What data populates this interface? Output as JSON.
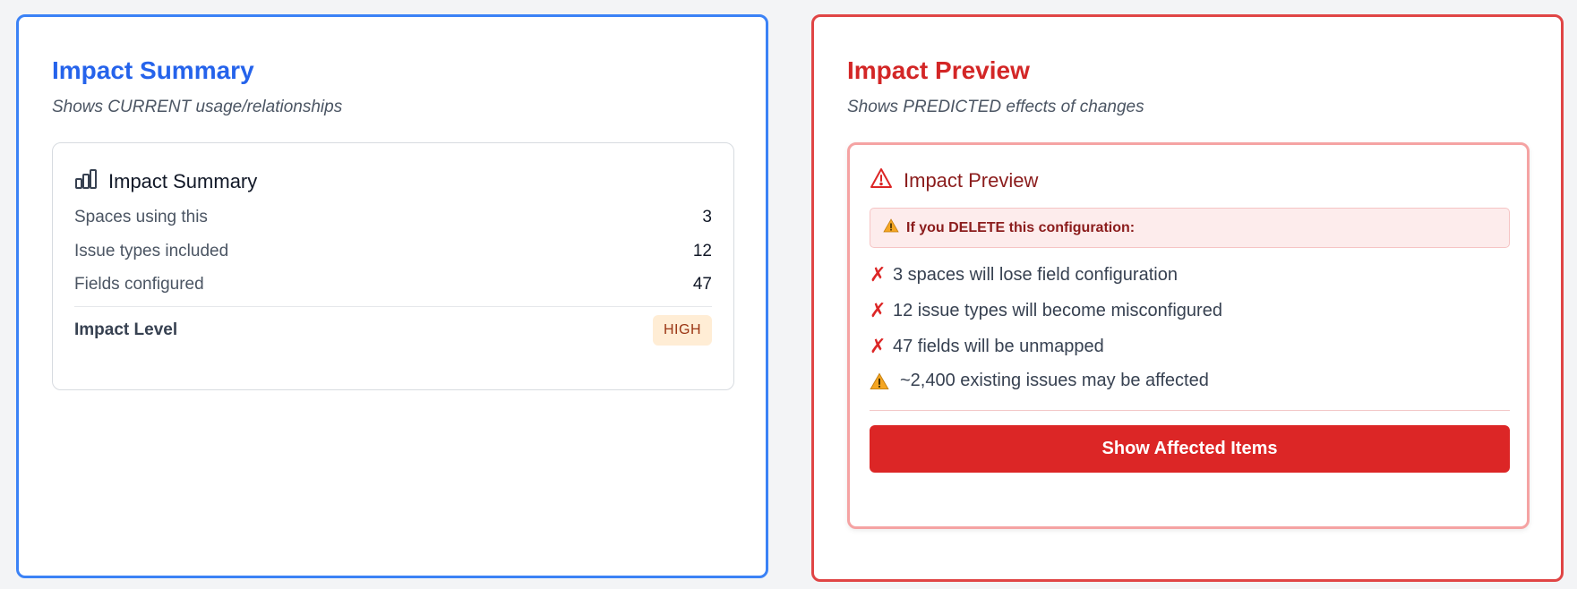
{
  "left_panel": {
    "title": "Impact Summary",
    "subtitle": "Shows CURRENT usage/relationships",
    "card": {
      "icon": "bar-chart-icon",
      "title": "Impact Summary",
      "stats": [
        {
          "label": "Spaces using this",
          "value": "3"
        },
        {
          "label": "Issue types included",
          "value": "12"
        },
        {
          "label": "Fields configured",
          "value": "47"
        }
      ],
      "impact_level_label": "Impact Level",
      "impact_level_value": "HIGH"
    }
  },
  "right_panel": {
    "title": "Impact Preview",
    "subtitle": "Shows PREDICTED effects of changes",
    "card": {
      "icon": "warning-triangle-icon",
      "title": "Impact Preview",
      "alert_text": "If you DELETE this configuration:",
      "effects": [
        {
          "icon": "x-mark-icon",
          "text": "3 spaces will lose field configuration"
        },
        {
          "icon": "x-mark-icon",
          "text": "12 issue types will become misconfigured"
        },
        {
          "icon": "x-mark-icon",
          "text": "47 fields will be unmapped"
        },
        {
          "icon": "warning-icon",
          "text": "~2,400 existing issues may be affected"
        }
      ],
      "button_label": "Show Affected Items"
    }
  },
  "colors": {
    "blue_accent": "#2563eb",
    "red_accent": "#dc2626",
    "badge_bg": "#ffedd5",
    "badge_text": "#9a3412"
  }
}
